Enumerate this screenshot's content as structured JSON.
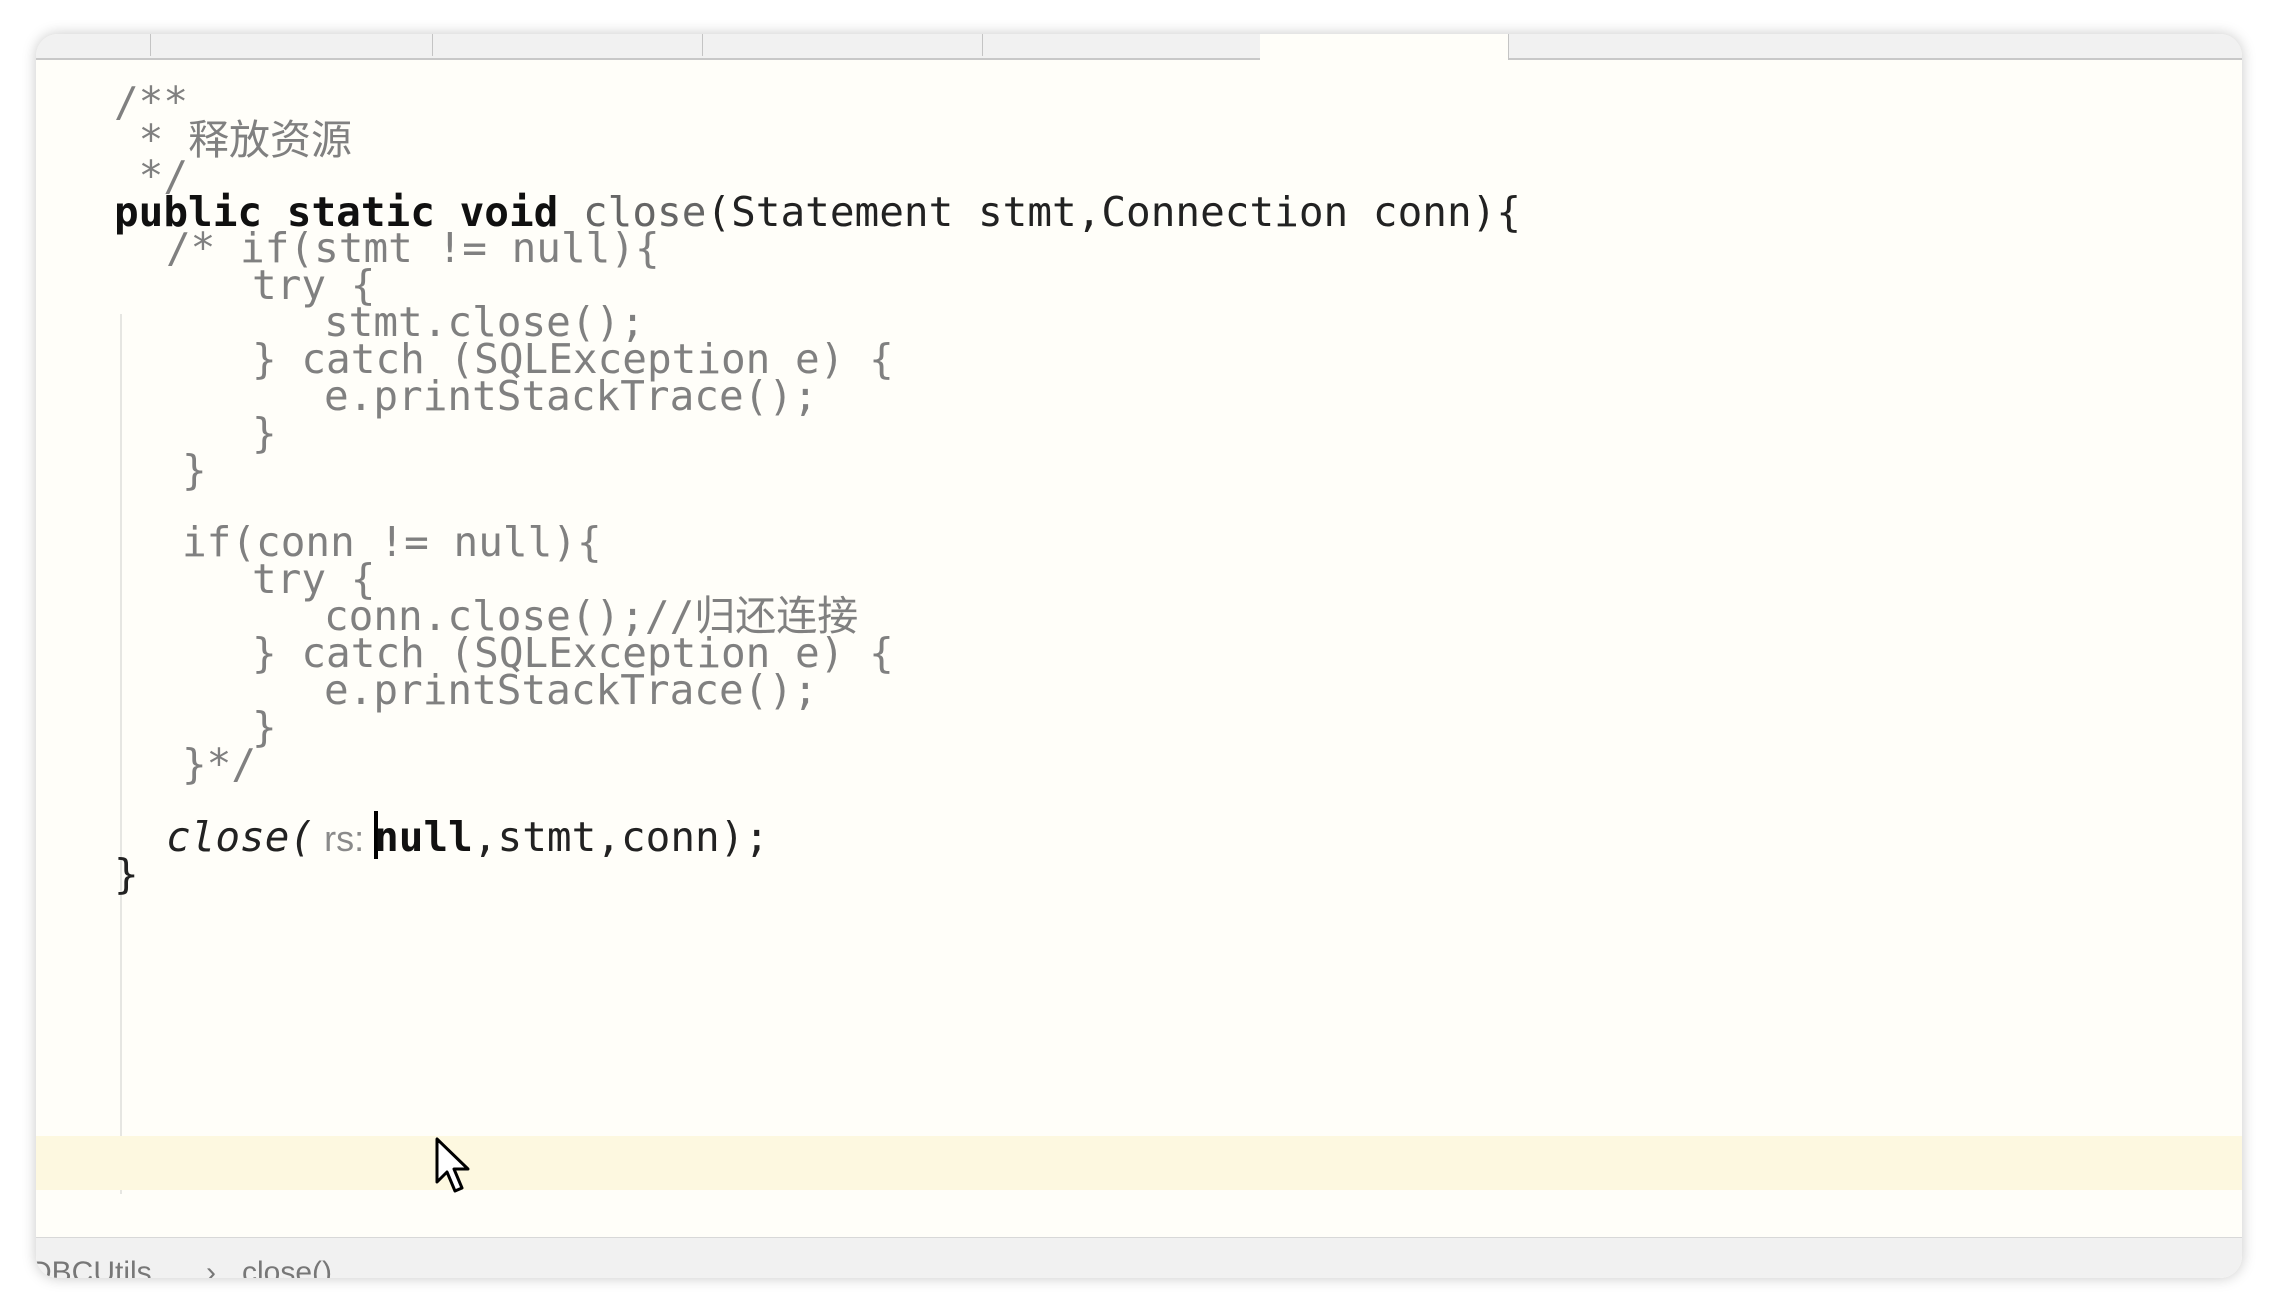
{
  "editor": {
    "lines": {
      "l1": "/**",
      "l2_star": " * ",
      "l2_zh": "释放资源",
      "l3": " */",
      "l4_kw": "public static void ",
      "l4_name": "close",
      "l4_rest": "(Statement stmt,Connection conn){",
      "l5": "/* if(stmt != null){",
      "l6": "try {",
      "l7": "stmt.close();",
      "l8": "} catch (SQLException e) {",
      "l9": "e.printStackTrace();",
      "l10": "}",
      "l11": "}",
      "l12": "if(conn != null){",
      "l13": "try {",
      "l14_code": "conn.close();//",
      "l14_zh": "归还连接",
      "l15": "} catch (SQLException e) {",
      "l16": "e.printStackTrace();",
      "l17": "}",
      "l18": "}*/",
      "l19_call": "close(",
      "l19_hint": " rs: ",
      "l19_null": "null",
      "l19_rest": ",stmt,conn);",
      "l20": "}"
    }
  },
  "status_bar": {
    "crumb_class": "DBCUtils",
    "separator": "›",
    "crumb_method": "close()"
  },
  "colors": {
    "background": "#fffef9",
    "current_line": "#fdf8e0",
    "keyword": "#101010",
    "comment": "#808080"
  }
}
